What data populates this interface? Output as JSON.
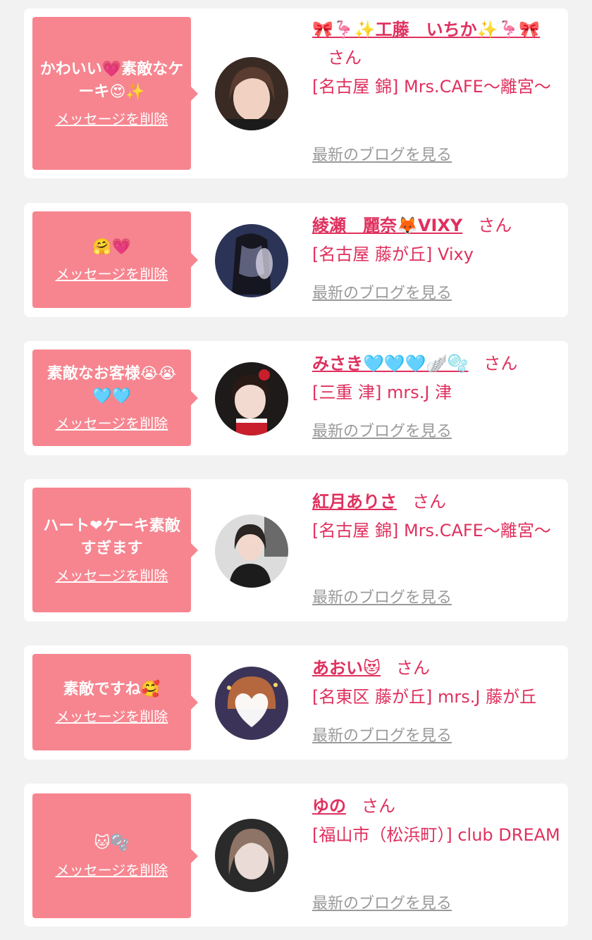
{
  "items": [
    {
      "message": "かわいい💗素敵なケーキ😍✨",
      "delete_label": "メッセージを削除",
      "name": "🎀🦩✨工藤　いちか✨🦩🎀",
      "honorific": "さん",
      "shop": "[名古屋 錦] Mrs.CAFE〜離宮〜",
      "blog_label": "最新のブログを見る",
      "avatar_icon": "profile-photo"
    },
    {
      "message": "🤗💗",
      "delete_label": "メッセージを削除",
      "name": "綾瀬　麗奈🦊VIXY",
      "honorific": "さん",
      "shop": "[名古屋 藤が丘] Vixy",
      "blog_label": "最新のブログを見る",
      "avatar_icon": "profile-photo"
    },
    {
      "message": "素敵なお客様😭😭🩵🩵",
      "delete_label": "メッセージを削除",
      "name": "みさき🩵🩵🩵🪽🫧",
      "honorific": "さん",
      "shop": "[三重 津] mrs.J 津",
      "blog_label": "最新のブログを見る",
      "avatar_icon": "profile-photo"
    },
    {
      "message": "ハート❤ケーキ素敵すぎます",
      "delete_label": "メッセージを削除",
      "name": "紅月ありさ",
      "honorific": "さん",
      "shop": "[名古屋 錦] Mrs.CAFE〜離宮〜",
      "blog_label": "最新のブログを見る",
      "avatar_icon": "profile-photo"
    },
    {
      "message": "素敵ですね🥰",
      "delete_label": "メッセージを削除",
      "name": "あおい😻",
      "honorific": "さん",
      "shop": "[名東区 藤が丘] mrs.J 藤が丘",
      "blog_label": "最新のブログを見る",
      "avatar_icon": "profile-photo"
    },
    {
      "message": "🐱🫧",
      "delete_label": "メッセージを削除",
      "name": "ゆの",
      "honorific": "さん",
      "shop": "[福山市（松浜町）] club DREAM",
      "blog_label": "最新のブログを見る",
      "avatar_icon": "profile-photo"
    }
  ],
  "colors": {
    "accent": "#e0305e",
    "bubble": "#f7858f",
    "background": "#f2f2f2",
    "muted": "#9a9a9a"
  }
}
